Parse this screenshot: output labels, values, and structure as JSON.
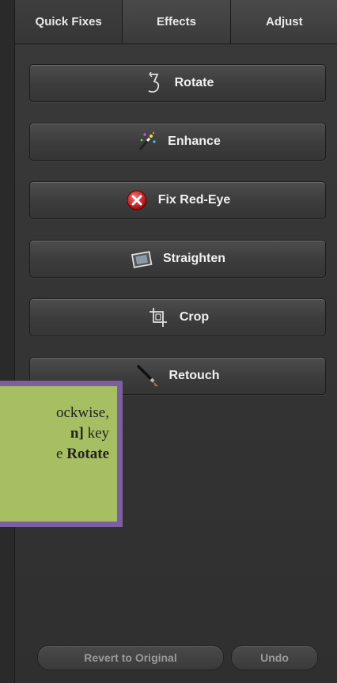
{
  "tabs": [
    {
      "label": "Quick Fixes",
      "active": true
    },
    {
      "label": "Effects",
      "active": false
    },
    {
      "label": "Adjust",
      "active": false
    }
  ],
  "buttons": [
    {
      "label": "Rotate",
      "icon": "rotate-icon"
    },
    {
      "label": "Enhance",
      "icon": "magic-wand-icon"
    },
    {
      "label": "Fix Red-Eye",
      "icon": "red-x-icon"
    },
    {
      "label": "Straighten",
      "icon": "straighten-icon"
    },
    {
      "label": "Crop",
      "icon": "crop-icon"
    },
    {
      "label": "Retouch",
      "icon": "brush-icon"
    }
  ],
  "bottom": {
    "revert_label": "Revert to Original",
    "undo_label": "Undo"
  },
  "callout": {
    "line1": "ockwise,",
    "line2_bold": "n]",
    "line2_rest": " key",
    "line3_pre": "e ",
    "line3_bold": "Rotate"
  },
  "colors": {
    "panel_bg": "#353535",
    "callout_bg": "#a6bf62",
    "callout_border": "#7b5fa0",
    "red_eye_icon": "#d02020"
  }
}
